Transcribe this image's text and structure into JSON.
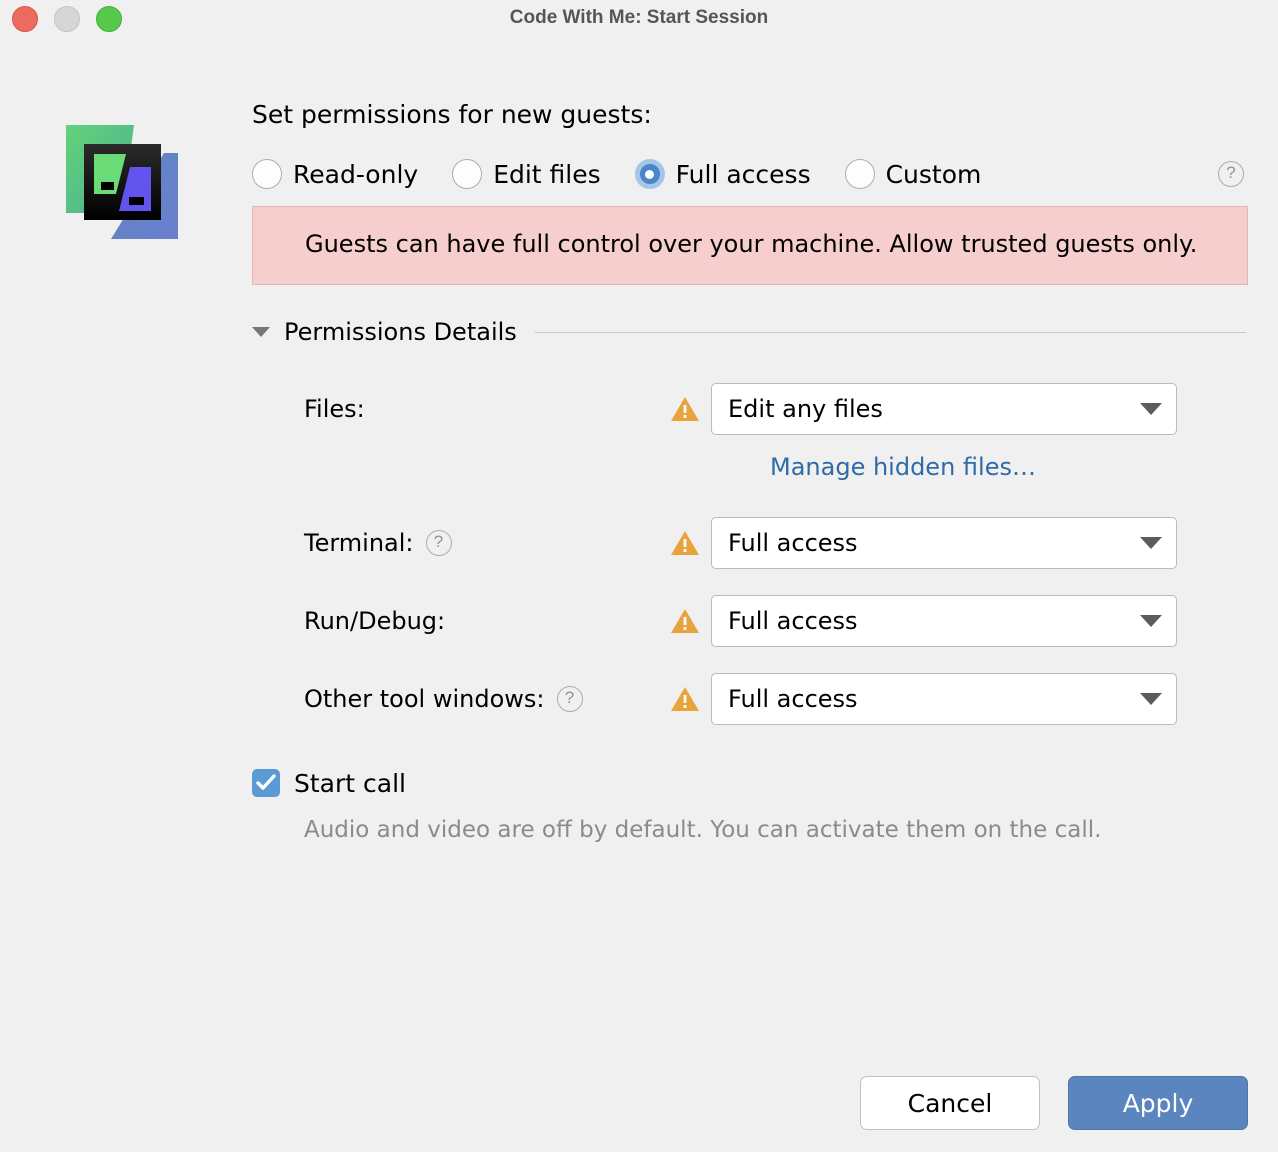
{
  "window": {
    "title": "Code With Me: Start Session",
    "traffic_lights": [
      "close",
      "minimize",
      "maximize"
    ],
    "colors": {
      "close": "#EC6A5E",
      "minimize": "#D6D6D6",
      "maximize": "#56C84A",
      "accent": "#5A85BE",
      "warning_bg": "#F6CECE",
      "link": "#2F6BA8",
      "warn_icon": "#E8A33D"
    }
  },
  "logo": {
    "name": "code-with-me-logo"
  },
  "permissions": {
    "heading": "Set permissions for new guests:",
    "options": [
      {
        "label": "Read-only",
        "selected": false
      },
      {
        "label": "Edit files",
        "selected": false
      },
      {
        "label": "Full access",
        "selected": true
      },
      {
        "label": "Custom",
        "selected": false
      }
    ],
    "help_icon": "?",
    "warning": "Guests can have full control over your machine. Allow trusted guests only."
  },
  "details": {
    "title": "Permissions Details",
    "expanded": true,
    "rows": [
      {
        "label": "Files:",
        "has_help": false,
        "has_warning": true,
        "value": "Edit any files"
      },
      {
        "label": "Terminal:",
        "has_help": true,
        "has_warning": true,
        "value": "Full access"
      },
      {
        "label": "Run/Debug:",
        "has_help": false,
        "has_warning": true,
        "value": "Full access"
      },
      {
        "label": "Other tool windows:",
        "has_help": true,
        "has_warning": true,
        "value": "Full access"
      }
    ],
    "manage_hidden_files_link": "Manage hidden files…"
  },
  "start_call": {
    "label": "Start call",
    "checked": true,
    "hint": "Audio and video are off by default. You can activate them on the call."
  },
  "footer": {
    "cancel_label": "Cancel",
    "apply_label": "Apply"
  }
}
